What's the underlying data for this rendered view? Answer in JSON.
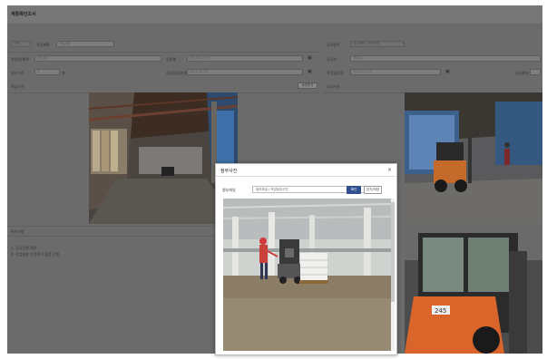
{
  "window": {
    "title": "계통확인조서"
  },
  "left": {
    "filter_prefix": "선택",
    "filter_label": "작업계획",
    "filter_value": "작업계획",
    "row1": {
      "label_a": "작업명/계획",
      "value_a": "공정검사",
      "label_b": "공종별",
      "value_b": "공정검사 / 승인"
    },
    "row2": {
      "label_a": "검사기준",
      "value_a": "1",
      "unit": "층",
      "label_b": "검사일/검사일",
      "value_b": "2021-01-11"
    },
    "row3": {
      "label_a": "작업사진",
      "button": "사진추가"
    },
    "notes": {
      "label": "특이사항",
      "line1": "1. 공사진행 확인",
      "line2": "2. 작업현장 안전관리 점검 진행"
    }
  },
  "right": {
    "row0": {
      "label": "검사항목",
      "value": "검사항목 / 안전관리"
    },
    "row1": {
      "label": "검사자",
      "value": "작업자"
    },
    "row2": {
      "label": "작업검사일",
      "value": "2021-01-11",
      "label_c": "검사결과"
    },
    "row3": {
      "label": "검사사진"
    }
  },
  "modal": {
    "title": "첨부사진",
    "close": "×",
    "select_label": "첨부파일",
    "select_value": "첨부파일 / 작업현장사진",
    "chevron": "⌄",
    "btn_primary": "확인",
    "btn_secondary": "닫기/저장",
    "photo_text": "245"
  },
  "colors": {
    "overlay": "#6b6b6b",
    "primary": "#2f4f8f",
    "machine": "#d9652b"
  }
}
